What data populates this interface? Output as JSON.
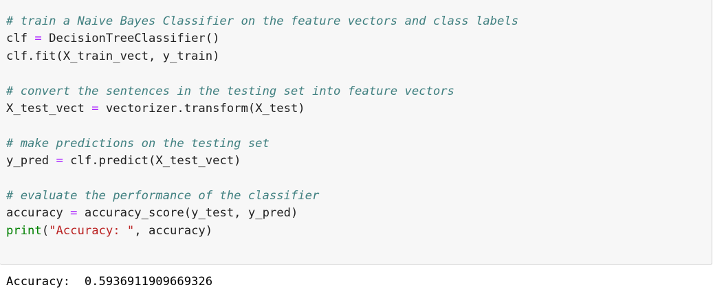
{
  "cell": {
    "lines": [
      {
        "comment": "# train a Naive Bayes Classifier on the feature vectors and class labels"
      },
      {
        "lhs": "clf",
        "op": "=",
        "rhs": "DecisionTreeClassifier()"
      },
      {
        "text": "clf.fit(X_train_vect, y_train)"
      },
      {
        "blank": ""
      },
      {
        "comment": "# convert the sentences in the testing set into feature vectors"
      },
      {
        "lhs": "X_test_vect",
        "op": "=",
        "rhs": "vectorizer.transform(X_test)"
      },
      {
        "blank": ""
      },
      {
        "comment": "# make predictions on the testing set"
      },
      {
        "lhs": "y_pred",
        "op": "=",
        "rhs": "clf.predict(X_test_vect)"
      },
      {
        "blank": ""
      },
      {
        "comment": "# evaluate the performance of the classifier"
      },
      {
        "lhs": "accuracy",
        "op": "=",
        "rhs": "accuracy_score(y_test, y_pred)"
      },
      {
        "func": "print",
        "paren_open": "(",
        "string": "\"Accuracy: \"",
        "rest": ", accuracy)"
      }
    ]
  },
  "output": {
    "text": "Accuracy:  0.5936911909669326"
  },
  "colors": {
    "cell_background": "#f7f7f7",
    "cell_border": "#cfcfcf",
    "comment": "#408080",
    "operator": "#aa22ff",
    "builtin": "#008000",
    "string": "#ba2121"
  }
}
